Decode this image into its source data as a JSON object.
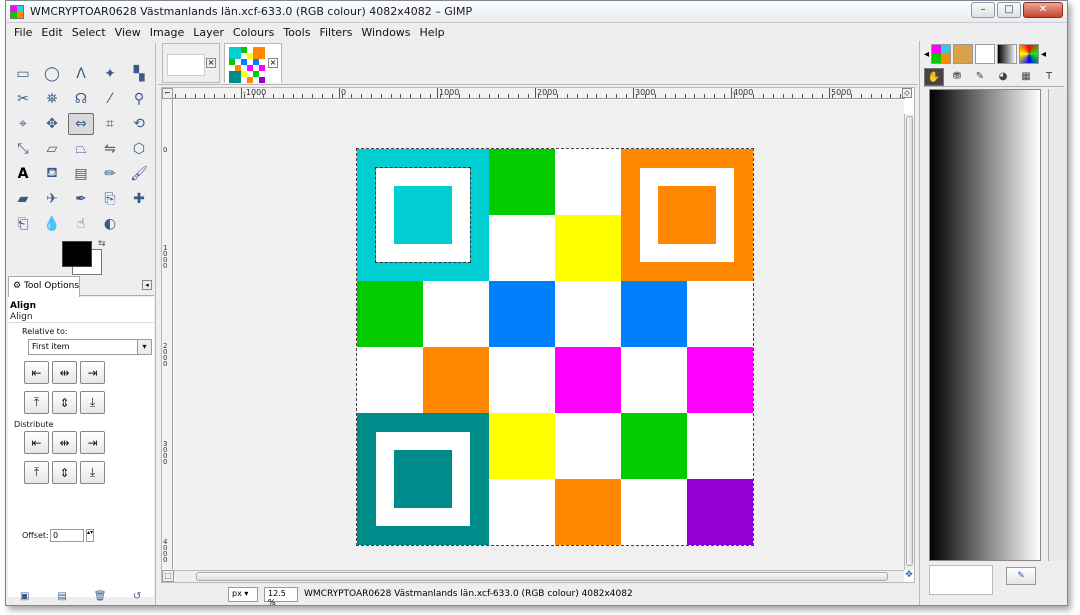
{
  "window": {
    "title": "WMCRYPTOAR0628 Västmanlands län.xcf-633.0 (RGB colour) 4082x4082 – GIMP",
    "buttons": [
      "–",
      "□",
      "✕"
    ]
  },
  "menubar": [
    "File",
    "Edit",
    "Select",
    "View",
    "Image",
    "Layer",
    "Colours",
    "Tools",
    "Filters",
    "Windows",
    "Help"
  ],
  "toolbox": {
    "tools": [
      "rect-select",
      "ellipse-select",
      "free-select",
      "fuzzy-select",
      "color-select",
      "scissors-select",
      "foreground-select",
      "paths",
      "color-picker",
      "zoom",
      "measure",
      "move",
      "align",
      "crop",
      "rotate",
      "scale",
      "shear",
      "perspective",
      "flip",
      "cage-transform",
      "text",
      "bucket-fill",
      "blend",
      "pencil",
      "paintbrush",
      "eraser",
      "airbrush",
      "ink",
      "clone",
      "heal",
      "perspective-clone",
      "blur",
      "smudge",
      "dodge-burn"
    ],
    "active_tool": "align",
    "tool_options_tab": "Tool Options",
    "options": {
      "heading": "Align",
      "subheading": "Align",
      "relative_to_label": "Relative to:",
      "relative_to_value": "First item",
      "distribute_label": "Distribute",
      "offset_label": "Offset:",
      "offset_value": "0"
    }
  },
  "canvas": {
    "ruler_labels": [
      "-1000",
      "0",
      "1000",
      "2000",
      "3000",
      "4000",
      "5000"
    ],
    "vruler_labels": [
      "0",
      "1000",
      "2000",
      "3000",
      "4000"
    ],
    "qr_colors": {
      "cyan": "#00ced1",
      "orange": "#ff8800",
      "teal": "#008b8b",
      "green": "#00cc00",
      "yellow": "#ffff00",
      "blue": "#0080ff",
      "magenta": "#ff00ff",
      "purple": "#9400d3",
      "white": "#ffffff"
    },
    "qr_grid": [
      [
        "F",
        "F",
        "green",
        "white",
        "F",
        "F"
      ],
      [
        "F",
        "F",
        "white",
        "yellow",
        "F",
        "F"
      ],
      [
        "green",
        "white",
        "blue",
        "white",
        "blue",
        "white"
      ],
      [
        "white",
        "orange",
        "white",
        "magenta",
        "white",
        "magenta"
      ],
      [
        "F",
        "F",
        "yellow",
        "white",
        "green",
        "white"
      ],
      [
        "F",
        "F",
        "white",
        "orange",
        "white",
        "purple"
      ]
    ]
  },
  "status": {
    "unit": "px",
    "zoom": "12.5 %",
    "text": "WMCRYPTOAR0628 Västmanlands län.xcf-633.0 (RGB colour) 4082x4082"
  }
}
